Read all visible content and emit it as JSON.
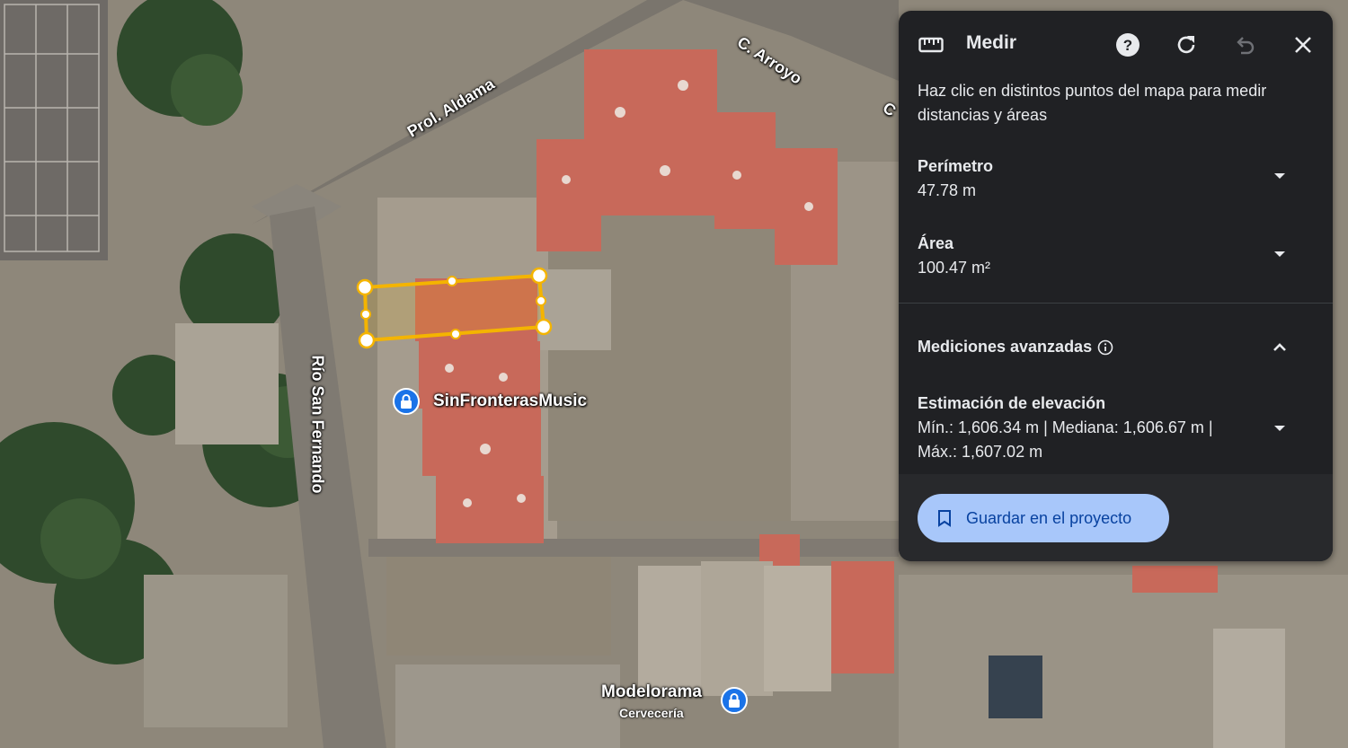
{
  "map": {
    "street_labels": [
      "Prol. Aldama",
      "C. Arroyo",
      "Río San Fernando",
      "C"
    ],
    "places": [
      {
        "name": "SinFronterasMusic",
        "category": "",
        "icon": "lock-pin-icon"
      },
      {
        "name": "Modelorama",
        "category": "Cervecería",
        "icon": "lock-pin-icon"
      }
    ],
    "measure_shape_color": "#f4b400"
  },
  "panel": {
    "title": "Medir",
    "icons": {
      "ruler": "ruler-icon",
      "help": "help-icon",
      "reset": "refresh-icon",
      "undo": "undo-icon",
      "close": "close-icon"
    },
    "instructions": "Haz clic en distintos puntos del mapa para medir distancias y áreas",
    "perimeter": {
      "label": "Perímetro",
      "value": "47.78 m"
    },
    "area": {
      "label": "Área",
      "value": "100.47 m²"
    },
    "advanced": {
      "label": "Mediciones avanzadas",
      "elevation_title": "Estimación de elevación",
      "elevation_line1": "Mín.: 1,606.34 m | Mediana: 1,606.67 m |",
      "elevation_line2": "Máx.: 1,607.02 m"
    },
    "save_button": "Guardar en el proyecto",
    "accent": "#a8c7fa"
  }
}
